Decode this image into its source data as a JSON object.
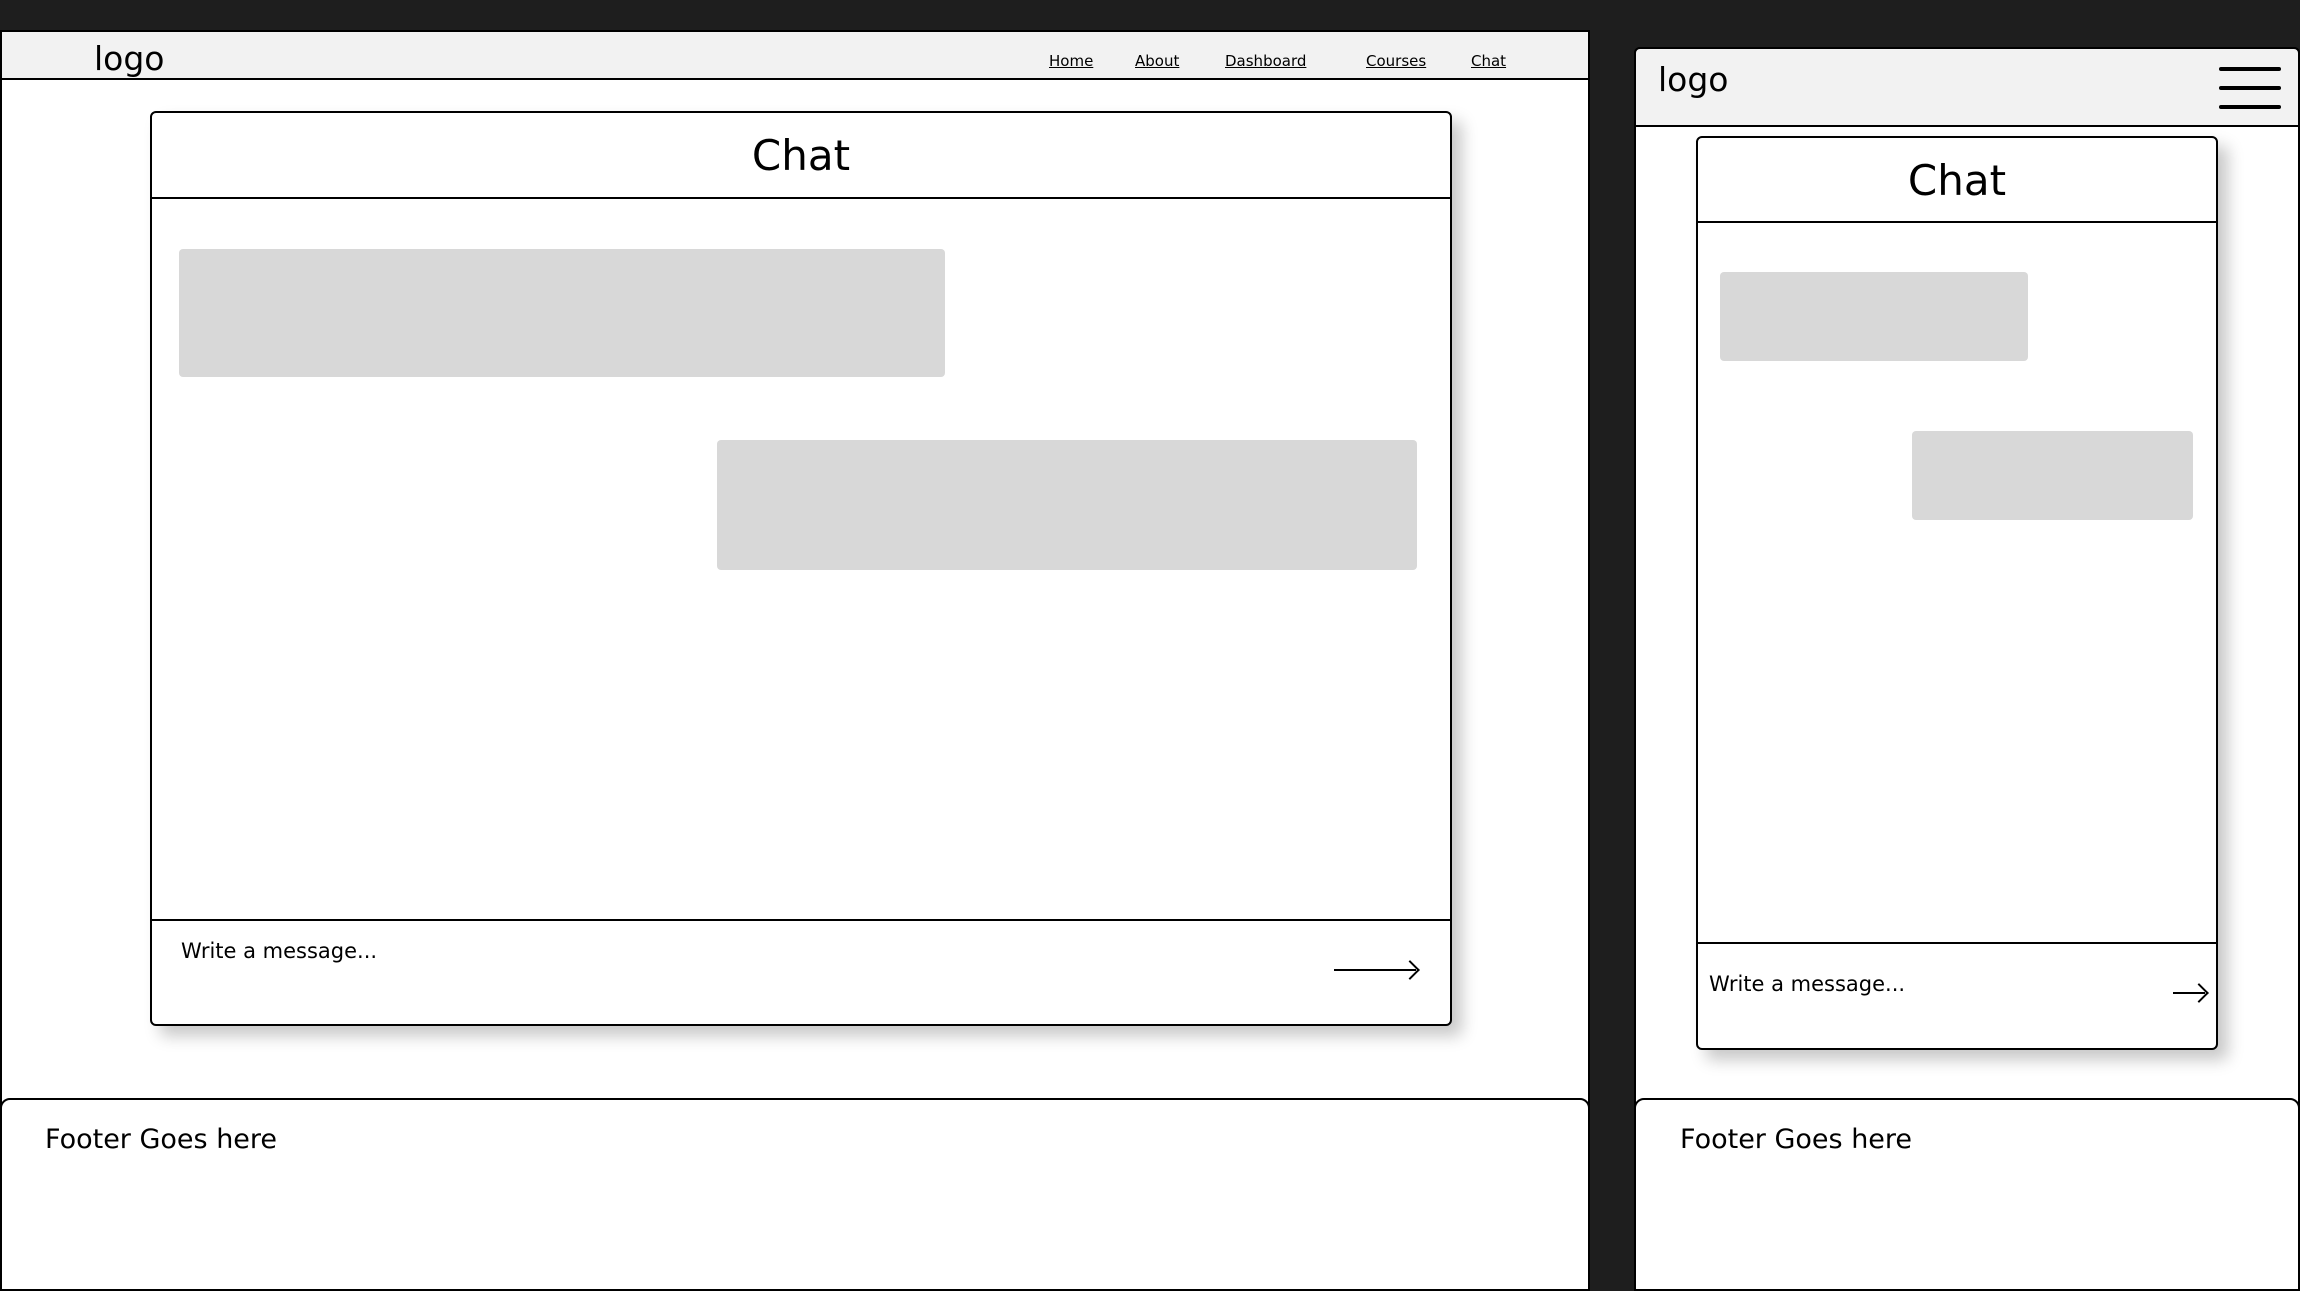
{
  "desktop": {
    "logo": "logo",
    "nav": [
      "Home",
      "About",
      "Dashboard",
      "Courses",
      "Chat"
    ],
    "chat_title": "Chat",
    "message_placeholder": "Write a message...",
    "footer": "Footer Goes here"
  },
  "mobile": {
    "logo": "logo",
    "menu_icon": "hamburger-menu-icon",
    "chat_title": "Chat",
    "message_placeholder": "Write a message...",
    "footer": "Footer Goes here"
  },
  "colors": {
    "background": "#1e1e1e",
    "navbar": "#f2f2f2",
    "bubble": "#d8d8d8"
  }
}
